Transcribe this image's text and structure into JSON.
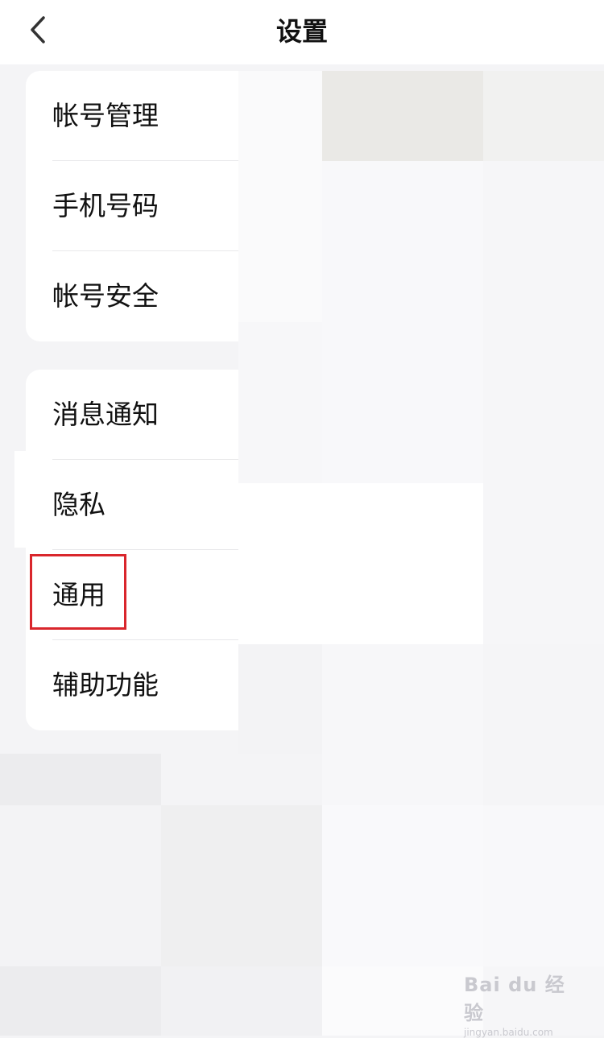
{
  "header": {
    "title": "设置",
    "back_icon": "chevron-left-icon"
  },
  "groups": [
    {
      "items": [
        {
          "label": "帐号管理"
        },
        {
          "label": "手机号码"
        },
        {
          "label": "帐号安全"
        }
      ]
    },
    {
      "items": [
        {
          "label": "消息通知"
        },
        {
          "label": "隐私"
        },
        {
          "label": "通用",
          "highlighted": true
        },
        {
          "label": "辅助功能"
        }
      ]
    }
  ],
  "watermark": {
    "brand": "Bai du 经验",
    "url": "jingyan.baidu.com"
  },
  "colors": {
    "highlight": "#d9262c",
    "background": "#f4f4f6",
    "card": "#ffffff"
  }
}
